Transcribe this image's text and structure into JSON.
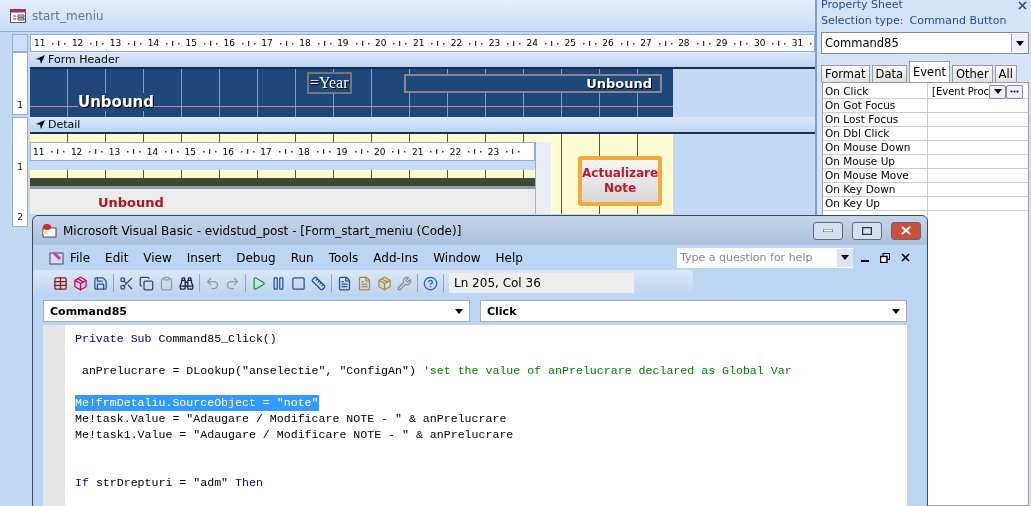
{
  "designer": {
    "title": "start_meniu",
    "top_ruler": [
      "11",
      "12",
      "13",
      "14",
      "15",
      "16",
      "17",
      "18",
      "19",
      "20",
      "21",
      "22",
      "23",
      "24",
      "25",
      "26",
      "27",
      "28",
      "29",
      "30",
      "31"
    ],
    "sections": [
      {
        "kind": "header",
        "label": "Form Header",
        "ruler": [
          "1"
        ]
      },
      {
        "kind": "detail",
        "label": "Detail",
        "ruler": [
          "1",
          "2"
        ]
      }
    ],
    "header_controls": [
      {
        "kind": "expression",
        "text": "=Year"
      },
      {
        "kind": "label",
        "text": "Unbound"
      },
      {
        "kind": "right",
        "text": "Unbound"
      }
    ],
    "subform_ruler": [
      "11",
      "12",
      "13",
      "14",
      "15",
      "16",
      "17",
      "18",
      "19",
      "20",
      "21",
      "22",
      "23"
    ],
    "detail_label": "Unbound",
    "command_button": {
      "text": "Actualizare Note",
      "selected": true
    }
  },
  "property_sheet": {
    "title": "Property Sheet",
    "selection_type_label": "Selection type:",
    "selection_type": "Command Button",
    "object": "Command85",
    "tabs": [
      {
        "label": "Format",
        "selected": false
      },
      {
        "label": "Data",
        "selected": false
      },
      {
        "label": "Event",
        "selected": true
      },
      {
        "label": "Other",
        "selected": false
      },
      {
        "label": "All",
        "selected": false
      }
    ],
    "rows": [
      {
        "name": "On Click",
        "value": "[Event Proc"
      },
      {
        "name": "On Got Focus"
      },
      {
        "name": "On Lost Focus"
      },
      {
        "name": "On Dbl Click"
      },
      {
        "name": "On Mouse Down"
      },
      {
        "name": "On Mouse Up"
      },
      {
        "name": "On Mouse Move"
      },
      {
        "name": "On Key Down"
      },
      {
        "name": "On Key Up"
      }
    ]
  },
  "vb_window": {
    "title": "Microsoft Visual Basic - evidstud_post - [Form_start_meniu (Code)]",
    "menu": [
      "File",
      "Edit",
      "View",
      "Insert",
      "Debug",
      "Run",
      "Tools",
      "Add-Ins",
      "Window",
      "Help"
    ],
    "help_search": {
      "placeholder": "Type a question for help"
    },
    "position": "Ln 205, Col 36",
    "object_combo": "Command85",
    "procedure_combo": "Click",
    "code": [
      {
        "selected": false,
        "tokens": [
          {
            "kind": "keyword",
            "text": "Private Sub"
          },
          {
            "kind": "plain",
            "text": " Command85_Click()"
          }
        ]
      },
      {
        "kind": "blank"
      },
      {
        "selected": false,
        "tokens": [
          {
            "kind": "plain",
            "text": " anPrelucrare = DLookup(\"anselectie\", \"ConfigAn\") "
          },
          {
            "kind": "comment",
            "text": "'set the value of anPrelucrare declared as Global Var"
          }
        ]
      },
      {
        "kind": "blank"
      },
      {
        "selected": true,
        "tokens": [
          {
            "kind": "plain",
            "text": "Me!frmDetaliu.SourceObject = \"note\""
          }
        ]
      },
      {
        "selected": false,
        "tokens": [
          {
            "kind": "plain",
            "text": "Me!task.Value = \"Adaugare / Modificare NOTE - \" & anPrelucrare"
          }
        ]
      },
      {
        "selected": false,
        "tokens": [
          {
            "kind": "plain",
            "text": "Me!task1.Value = \"Adaugare / Modificare NOTE - \" & anPrelucrare"
          }
        ]
      },
      {
        "kind": "blank"
      },
      {
        "kind": "blank"
      },
      {
        "selected": false,
        "tokens": [
          {
            "kind": "keyword",
            "text": "If"
          },
          {
            "kind": "plain",
            "text": " strDrepturi = \"adm\" "
          },
          {
            "kind": "keyword",
            "text": "Then"
          }
        ]
      }
    ]
  }
}
